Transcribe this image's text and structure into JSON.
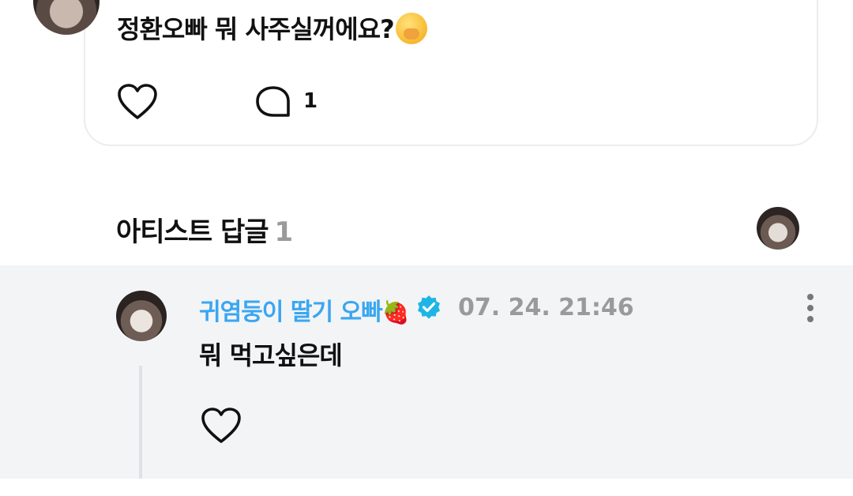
{
  "post": {
    "text": "정환오빠  뭐 사주실꺼에요?",
    "emoji_icon": "face-with-hand-over-mouth-emoji",
    "comment_count": "1"
  },
  "artist_replies": {
    "title": "아티스트 답글",
    "count": "1"
  },
  "reply": {
    "author": "귀염둥이 딸기 오빠",
    "author_emoji": "🍓",
    "timestamp": "07. 24. 21:46",
    "text": "뭐 먹고싶은데",
    "accent_color": "#3aa6f0",
    "verified_color": "#1eb5e6"
  }
}
